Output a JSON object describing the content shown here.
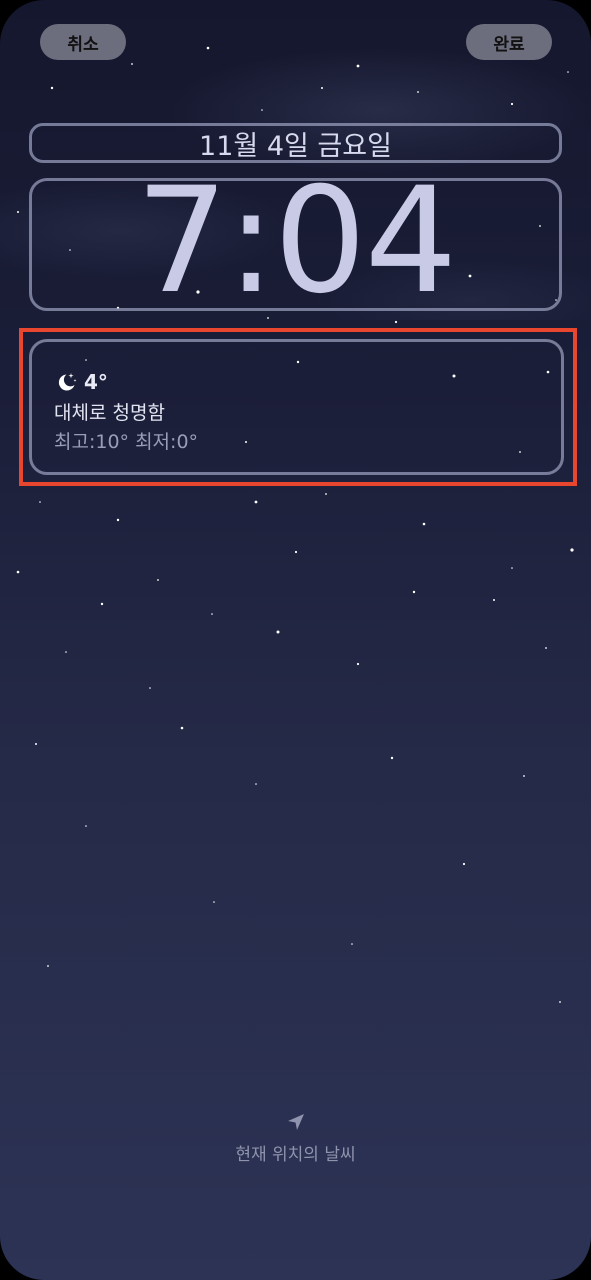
{
  "topbar": {
    "cancel_label": "취소",
    "done_label": "완료"
  },
  "lockscreen": {
    "date": "11월 4일 금요일",
    "time": "7:04"
  },
  "weather_widget": {
    "icon": "moon-stars-icon",
    "temperature": "4°",
    "condition": "대체로 청명함",
    "high_low": "최고:10° 최저:0°"
  },
  "footer": {
    "icon": "location-arrow-icon",
    "label": "현재 위치의 날씨"
  },
  "colors": {
    "highlight": "#e8462e",
    "text_primary": "#e9eaf6",
    "background_top": "#15172e",
    "background_bottom": "#2d3355"
  }
}
